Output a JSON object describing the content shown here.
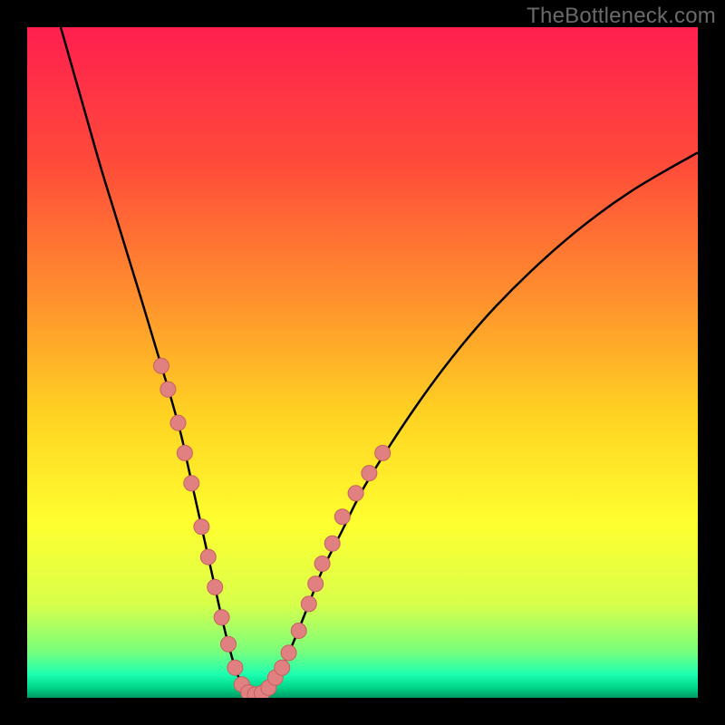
{
  "watermark": "TheBottleneck.com",
  "colors": {
    "frame": "#000000",
    "curve": "#000000",
    "marker_fill": "#e08080",
    "marker_stroke": "#c76060",
    "gradient_stops": [
      {
        "offset": 0.0,
        "color": "#ff1f4f"
      },
      {
        "offset": 0.2,
        "color": "#ff4a3a"
      },
      {
        "offset": 0.4,
        "color": "#ff8f2e"
      },
      {
        "offset": 0.58,
        "color": "#ffd322"
      },
      {
        "offset": 0.74,
        "color": "#ffff30"
      },
      {
        "offset": 0.86,
        "color": "#d8ff4a"
      },
      {
        "offset": 0.93,
        "color": "#7bff7b"
      },
      {
        "offset": 0.965,
        "color": "#1dffb0"
      },
      {
        "offset": 0.985,
        "color": "#00d68a"
      },
      {
        "offset": 1.0,
        "color": "#009a63"
      }
    ]
  },
  "chart_data": {
    "type": "line",
    "title": "",
    "xlabel": "",
    "ylabel": "",
    "xlim": [
      0,
      100
    ],
    "ylim": [
      0,
      100
    ],
    "x": [
      5,
      7,
      9,
      11,
      13,
      15,
      17,
      18.5,
      20,
      21.5,
      23,
      24,
      25,
      26,
      27,
      28,
      29,
      30,
      31,
      32,
      33,
      34,
      35,
      36,
      38,
      40,
      42,
      44,
      47,
      50,
      54,
      58,
      62,
      66,
      70,
      75,
      80,
      85,
      90,
      95,
      100
    ],
    "y_values": [
      100,
      93,
      86,
      79,
      72.5,
      66,
      59.5,
      54.5,
      49.5,
      44.5,
      39,
      34.5,
      30,
      25.5,
      21,
      16.5,
      12,
      8,
      4.5,
      2,
      0.8,
      0.5,
      0.7,
      1.5,
      4.5,
      9,
      14,
      19,
      25,
      31,
      37.5,
      43.5,
      49,
      54,
      58.5,
      63.5,
      68,
      72,
      75.5,
      78.5,
      81.3
    ],
    "markers": [
      {
        "x": 20.0,
        "y": 49.5
      },
      {
        "x": 21.0,
        "y": 46.0
      },
      {
        "x": 22.5,
        "y": 41.0
      },
      {
        "x": 23.5,
        "y": 36.5
      },
      {
        "x": 24.5,
        "y": 32.0
      },
      {
        "x": 26.0,
        "y": 25.5
      },
      {
        "x": 27.0,
        "y": 21.0
      },
      {
        "x": 28.0,
        "y": 16.5
      },
      {
        "x": 29.0,
        "y": 12.0
      },
      {
        "x": 30.0,
        "y": 8.0
      },
      {
        "x": 31.0,
        "y": 4.5
      },
      {
        "x": 32.0,
        "y": 2.0
      },
      {
        "x": 33.0,
        "y": 0.8
      },
      {
        "x": 34.0,
        "y": 0.5
      },
      {
        "x": 35.0,
        "y": 0.7
      },
      {
        "x": 36.0,
        "y": 1.5
      },
      {
        "x": 37.0,
        "y": 3.0
      },
      {
        "x": 38.0,
        "y": 4.5
      },
      {
        "x": 39.0,
        "y": 6.7
      },
      {
        "x": 40.5,
        "y": 10.0
      },
      {
        "x": 42.0,
        "y": 14.0
      },
      {
        "x": 43.0,
        "y": 17.0
      },
      {
        "x": 44.0,
        "y": 20.0
      },
      {
        "x": 45.5,
        "y": 23.0
      },
      {
        "x": 47.0,
        "y": 27.0
      },
      {
        "x": 49.0,
        "y": 30.5
      },
      {
        "x": 51.0,
        "y": 33.5
      },
      {
        "x": 53.0,
        "y": 36.5
      }
    ]
  }
}
